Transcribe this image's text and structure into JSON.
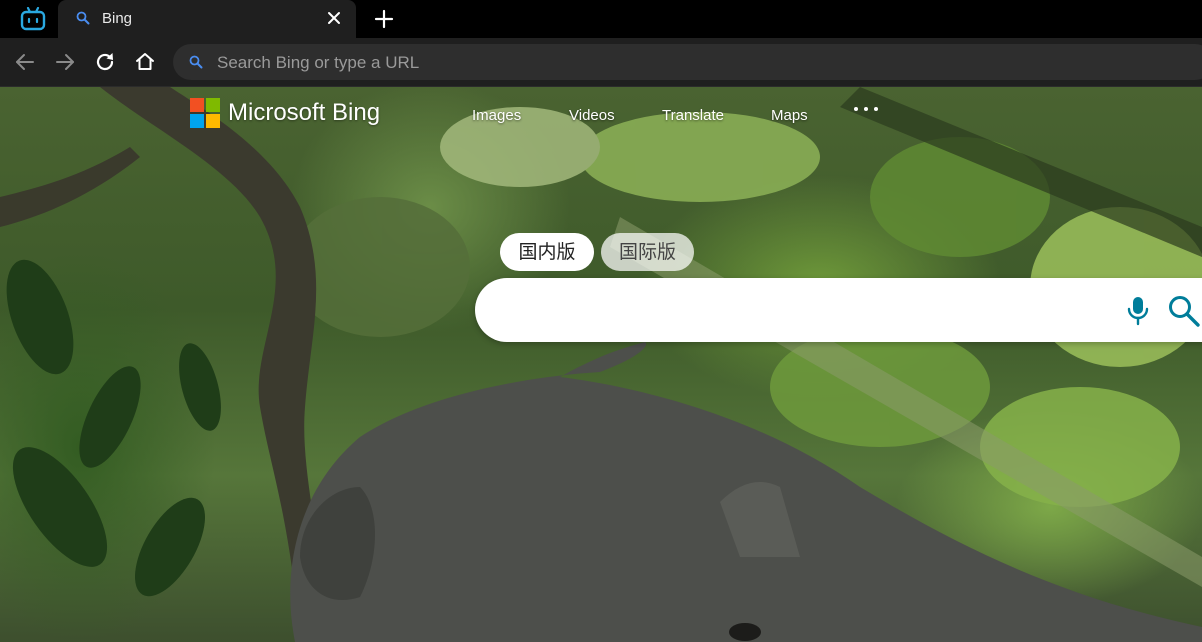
{
  "browser": {
    "tab": {
      "title": "Bing"
    },
    "omnibox": {
      "placeholder": "Search Bing or type a URL"
    }
  },
  "icons": {
    "app": "browser-app-icon",
    "tab_favicon": "search-icon",
    "tab_close": "close-icon",
    "new_tab": "plus-icon",
    "back": "arrow-left-icon",
    "forward": "arrow-right-icon",
    "reload": "reload-icon",
    "home": "home-icon",
    "voice": "microphone-icon",
    "search": "search-icon"
  },
  "bing": {
    "brand": "Microsoft Bing",
    "nav": [
      "Images",
      "Videos",
      "Translate",
      "Maps"
    ],
    "regions": [
      "国内版",
      "国际版"
    ],
    "search_value": ""
  },
  "colors": {
    "accent_blue": "#1a73e8",
    "bing_teal": "#007d9a",
    "ms_red": "#f25022",
    "ms_green": "#7fba00",
    "ms_blue": "#00a4ef",
    "ms_yellow": "#ffb900"
  }
}
